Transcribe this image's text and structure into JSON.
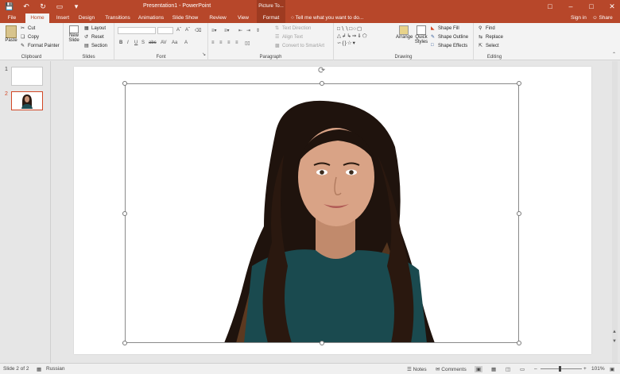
{
  "window": {
    "title": "Presentation1 - PowerPoint",
    "context_header": "Picture To..."
  },
  "tabs": [
    "File",
    "Home",
    "Insert",
    "Design",
    "Transitions",
    "Animations",
    "Slide Show",
    "Review",
    "View",
    "Format"
  ],
  "tell_me": "Tell me what you want to do...",
  "account": {
    "signin": "Sign in",
    "share": "Share"
  },
  "ribbon": {
    "clipboard": {
      "label": "Clipboard",
      "paste": "Paste",
      "cut": "Cut",
      "copy": "Copy",
      "format_painter": "Format Painter"
    },
    "slides": {
      "label": "Slides",
      "new_slide": "New",
      "new_slide2": "Slide",
      "layout": "Layout",
      "reset": "Reset",
      "section": "Section"
    },
    "font": {
      "label": "Font"
    },
    "paragraph": {
      "label": "Paragraph",
      "text_direction": "Text Direction",
      "align_text": "Align Text",
      "smartart": "Convert to SmartArt"
    },
    "drawing": {
      "label": "Drawing",
      "arrange": "Arrange",
      "quick_styles": "Quick",
      "quick_styles2": "Styles",
      "shape_fill": "Shape Fill",
      "shape_outline": "Shape Outline",
      "shape_effects": "Shape Effects"
    },
    "editing": {
      "label": "Editing",
      "find": "Find",
      "replace": "Replace",
      "select": "Select"
    }
  },
  "thumbnails": [
    {
      "num": "1"
    },
    {
      "num": "2"
    }
  ],
  "status": {
    "slide": "Slide 2 of 2",
    "language": "Russian",
    "notes": "Notes",
    "comments": "Comments",
    "zoom": "101%"
  },
  "colors": {
    "accent": "#b7472a",
    "ribbon": "#f3f3f3",
    "canvas": "#e6e6e6"
  }
}
